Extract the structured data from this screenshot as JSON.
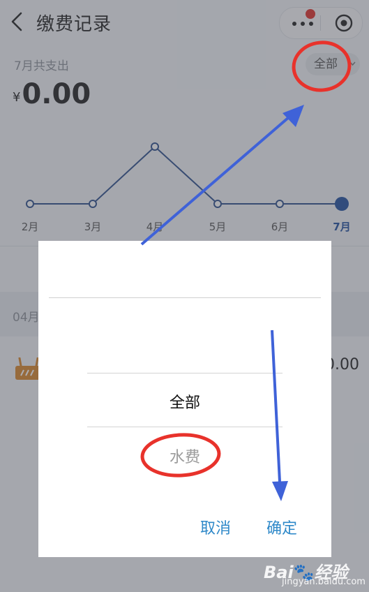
{
  "header": {
    "title": "缴费记录"
  },
  "summary": {
    "month_label": "7月共支出",
    "currency": "¥",
    "amount": "0.00",
    "filter_label": "全部"
  },
  "chart_data": {
    "type": "line",
    "categories": [
      "2月",
      "3月",
      "4月",
      "5月",
      "6月",
      "7月"
    ],
    "values": [
      0,
      0,
      1,
      0,
      0,
      0
    ],
    "active_category": "7月",
    "grid": false,
    "colors": {
      "line": "#2d4f8c",
      "active": "#1f4f9f"
    }
  },
  "list": {
    "section_date": "04月",
    "row_amount": "0.00"
  },
  "dialog": {
    "options": [
      "全部",
      "水费"
    ],
    "selected": "全部",
    "cancel_label": "取消",
    "confirm_label": "确定"
  },
  "watermark": {
    "logo_prefix": "Bai",
    "logo_suffix": "经验",
    "url": "jingyan.baidu.com"
  },
  "colors": {
    "accent": "#2f89c9",
    "annotation_red": "#e8322b",
    "annotation_blue": "#3f62d8",
    "router_orange": "#d9872b"
  }
}
